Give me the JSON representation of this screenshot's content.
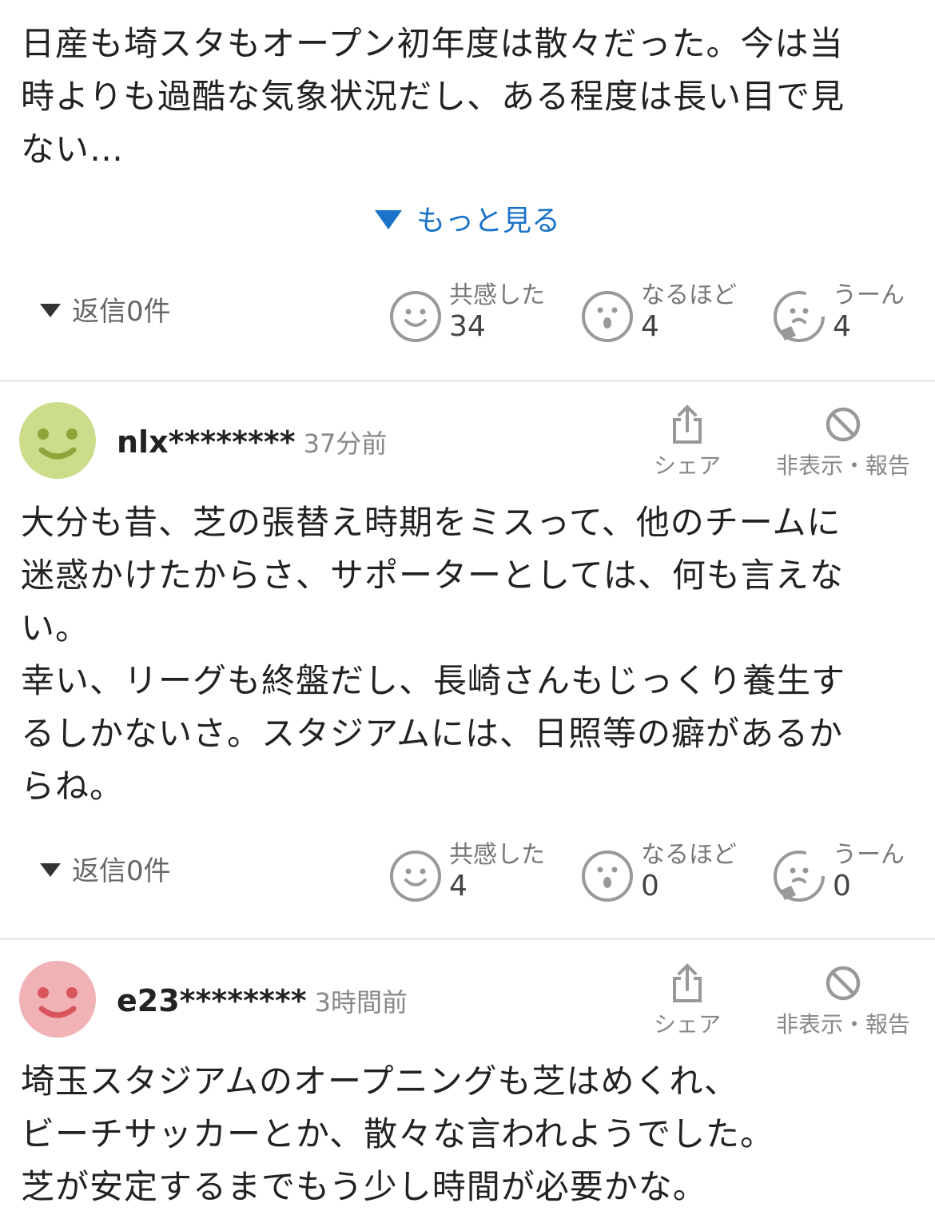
{
  "comments": [
    {
      "body": "日産も埼スタもオープン初年度は散々だった。今は当\n時よりも過酷な気象状況だし、ある程度は長い目で見\nない…",
      "more_label": "もっと見る",
      "reply_label": "返信0件",
      "reactions": [
        {
          "label": "共感した",
          "count": "34",
          "icon": "smile-face-icon"
        },
        {
          "label": "なるほど",
          "count": "4",
          "icon": "surprised-face-icon"
        },
        {
          "label": "うーん",
          "count": "4",
          "icon": "thinking-face-icon"
        }
      ]
    },
    {
      "user": "nlx********",
      "time": "37分前",
      "avatar_color": "#cbdd8a",
      "share_label": "シェア",
      "hide_label": "非表示・報告",
      "body": "大分も昔、芝の張替え時期をミスって、他のチームに\n迷惑かけたからさ、サポーターとしては、何も言えな\nい。\n幸い、リーグも終盤だし、長崎さんもじっくり養生す\nるしかないさ。スタジアムには、日照等の癖があるか\nらね。",
      "reply_label": "返信0件",
      "reactions": [
        {
          "label": "共感した",
          "count": "4",
          "icon": "smile-face-icon"
        },
        {
          "label": "なるほど",
          "count": "0",
          "icon": "surprised-face-icon"
        },
        {
          "label": "うーん",
          "count": "0",
          "icon": "thinking-face-icon"
        }
      ]
    },
    {
      "user": "e23********",
      "time": "3時間前",
      "avatar_color": "#f0b2b4",
      "share_label": "シェア",
      "hide_label": "非表示・報告",
      "body": "埼玉スタジアムのオープニングも芝はめくれ、\nビーチサッカーとか、散々な言われようでした。\n芝が安定するまでもう少し時間が必要かな。"
    }
  ],
  "colors": {
    "link": "#1a73c8",
    "divider": "#e9ecef",
    "icon_gray": "#999999"
  }
}
